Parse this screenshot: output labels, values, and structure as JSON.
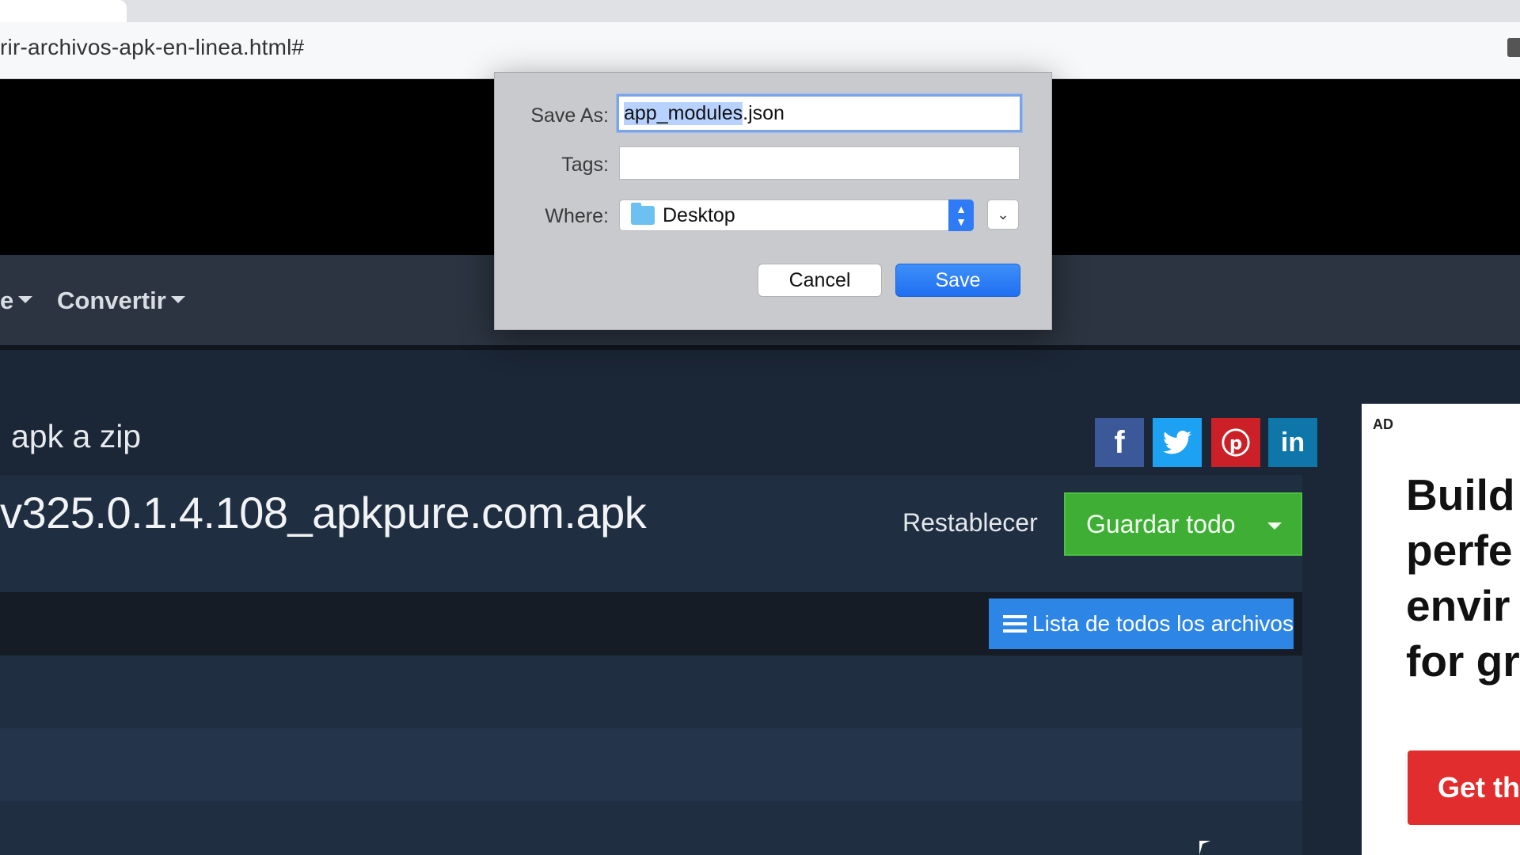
{
  "browser": {
    "url_fragment": "rir-archivos-apk-en-linea.html#"
  },
  "site": {
    "nav": {
      "item_partial": "e",
      "convert": "Convertir"
    },
    "page_title": "apk a zip",
    "file_name": "v325.0.1.4.108_apkpure.com.apk",
    "reset_label": "Restablecer",
    "save_all_label": "Guardar todo",
    "list_all_label": "Lista de todos los archivos",
    "social": {
      "facebook": "f",
      "twitter": "t",
      "pinterest": "p",
      "linkedin": "in"
    }
  },
  "ad": {
    "label": "AD",
    "headline": "Build\nperfe\nenvir\nfor gr",
    "cta": "Get th"
  },
  "dialog": {
    "save_as_label": "Save As:",
    "filename_selected": "app_modules",
    "filename_ext": ".json",
    "tags_label": "Tags:",
    "tags_value": "",
    "where_label": "Where:",
    "where_value": "Desktop",
    "cancel_label": "Cancel",
    "save_label": "Save"
  },
  "icons": {
    "chevron_down": "⌄",
    "stepper_up": "▲",
    "stepper_down": "▼"
  }
}
